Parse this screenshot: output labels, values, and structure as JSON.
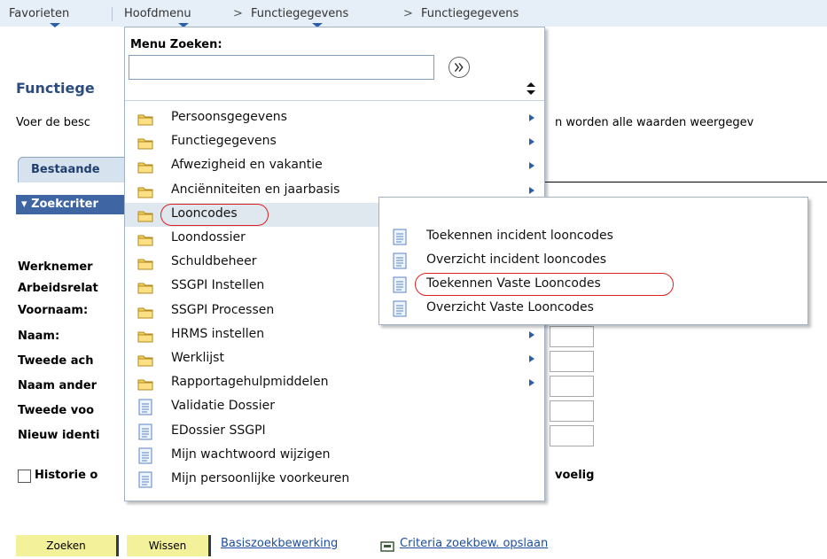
{
  "topnav": {
    "favorites": "Favorieten",
    "main_menu": "Hoofdmenu",
    "separator": ">",
    "crumb1": "Functiegegevens",
    "crumb2": "Functiegegevens"
  },
  "page": {
    "title": "Functiege",
    "description_left": "Voer de besc",
    "description_right": "n worden alle waarden weergegev",
    "tab_existing": "Bestaande",
    "criteria_header": "Zoekcriter",
    "fields": [
      "Werknemer",
      "Arbeidsrelat",
      "Voornaam:",
      "Naam:",
      "Tweede ach",
      "Naam ander",
      "Tweede voo",
      "Nieuw identi"
    ],
    "history_label": "Historie o",
    "history_tail": "voelig",
    "buttons": {
      "search": "Zoeken",
      "clear": "Wissen"
    },
    "links": {
      "basic_search": "Basiszoekbewerking",
      "save_criteria": "Criteria zoekbew. opslaan"
    }
  },
  "menu": {
    "search_label": "Menu Zoeken:",
    "search_value": "",
    "items": [
      {
        "label": "Persoonsgegevens",
        "type": "folder",
        "submenu": true
      },
      {
        "label": "Functiegegevens",
        "type": "folder",
        "submenu": true
      },
      {
        "label": "Afwezigheid en vakantie",
        "type": "folder",
        "submenu": true
      },
      {
        "label": "Anciënniteiten en jaarbasis",
        "type": "folder",
        "submenu": true
      },
      {
        "label": "Looncodes",
        "type": "folder",
        "submenu": false,
        "highlighted": true
      },
      {
        "label": "Loondossier",
        "type": "folder",
        "submenu": false
      },
      {
        "label": "Schuldbeheer",
        "type": "folder",
        "submenu": false
      },
      {
        "label": "SSGPI Instellen",
        "type": "folder",
        "submenu": false
      },
      {
        "label": "SSGPI Processen",
        "type": "folder",
        "submenu": false
      },
      {
        "label": "HRMS instellen",
        "type": "folder",
        "submenu": true
      },
      {
        "label": "Werklijst",
        "type": "folder",
        "submenu": true
      },
      {
        "label": "Rapportagehulpmiddelen",
        "type": "folder",
        "submenu": true
      },
      {
        "label": "Validatie Dossier",
        "type": "doc",
        "submenu": false
      },
      {
        "label": "EDossier SSGPI",
        "type": "doc",
        "submenu": false
      },
      {
        "label": "Mijn wachtwoord wijzigen",
        "type": "doc",
        "submenu": false
      },
      {
        "label": "Mijn persoonlijke voorkeuren",
        "type": "doc",
        "submenu": false
      }
    ]
  },
  "submenu": {
    "items": [
      "Toekennen incident looncodes",
      "Overzicht incident looncodes",
      "Toekennen Vaste Looncodes",
      "Overzicht Vaste Looncodes"
    ]
  },
  "colors": {
    "accent": "#2b5ea8",
    "highlight_circle": "#e02020",
    "button_yellow": "#f3f199",
    "header_bar": "#3f66a3"
  }
}
